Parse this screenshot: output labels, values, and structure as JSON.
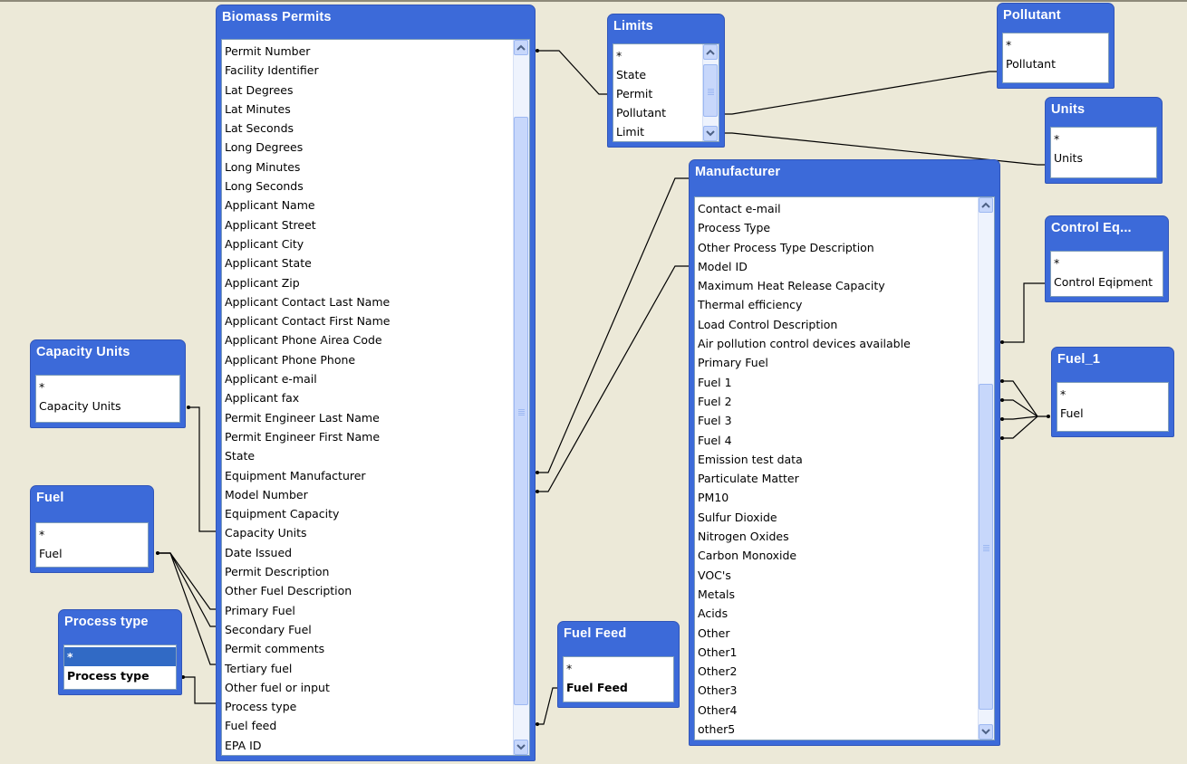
{
  "tables": {
    "biomass_permits": {
      "title": "Biomass Permits",
      "fields": [
        "Permit Number",
        "Facility Identifier",
        "Lat Degrees",
        "Lat Minutes",
        "Lat Seconds",
        "Long Degrees",
        "Long Minutes",
        "Long Seconds",
        "Applicant Name",
        "Applicant Street",
        "Applicant City",
        "Applicant State",
        "Applicant Zip",
        "Applicant Contact Last Name",
        "Applicant Contact First Name",
        "Applicant Phone Airea Code",
        "Applicant Phone Phone",
        "Applicant e-mail",
        "Applicant fax",
        "Permit Engineer Last Name",
        "Permit Engineer First Name",
        "State",
        "Equipment Manufacturer",
        "Model Number",
        "Equipment Capacity",
        "Capacity Units",
        "Date Issued",
        "Permit Description",
        "Other Fuel Description",
        "Primary Fuel",
        "Secondary Fuel",
        "Permit comments",
        "Tertiary fuel",
        "Other fuel or input",
        "Process type",
        "Fuel feed",
        "EPA ID"
      ]
    },
    "limits": {
      "title": "Limits",
      "fields": [
        "*",
        "State",
        "Permit",
        "Pollutant",
        "Limit"
      ]
    },
    "pollutant": {
      "title": "Pollutant",
      "fields": [
        "*",
        "Pollutant"
      ]
    },
    "units": {
      "title": "Units",
      "fields": [
        "*",
        "Units"
      ]
    },
    "manufacturer": {
      "title": "Manufacturer",
      "fields": [
        "Contact e-mail",
        "Process Type",
        "Other Process Type Description",
        "Model ID",
        "Maximum Heat Release Capacity",
        "Thermal efficiency",
        "Load Control Description",
        "Air pollution control devices available",
        "Primary Fuel",
        "Fuel 1",
        "Fuel 2",
        "Fuel 3",
        "Fuel 4",
        "Emission test data",
        "Particulate Matter",
        "PM10",
        "Sulfur Dioxide",
        "Nitrogen Oxides",
        "Carbon Monoxide",
        "VOC's",
        "Metals",
        "Acids",
        "Other",
        "Other1",
        "Other2",
        "Other3",
        "Other4",
        "other5"
      ]
    },
    "control_equipment": {
      "title": "Control Eq...",
      "fields": [
        "*",
        "Control Eqipment"
      ]
    },
    "fuel_1": {
      "title": "Fuel_1",
      "fields": [
        "*",
        "Fuel"
      ]
    },
    "capacity_units": {
      "title": "Capacity Units",
      "fields": [
        "*",
        "Capacity Units"
      ]
    },
    "fuel": {
      "title": "Fuel",
      "fields": [
        "*",
        "Fuel"
      ]
    },
    "process_type": {
      "title": "Process type",
      "fields": [
        "*",
        "Process type"
      ],
      "selected_field": "*"
    },
    "fuel_feed": {
      "title": "Fuel Feed",
      "fields": [
        "*",
        "Fuel Feed"
      ]
    }
  },
  "icons": {
    "scroll_up": "chevron-up-icon",
    "scroll_down": "chevron-down-icon"
  },
  "colors": {
    "title_bar": "#3c6ad9",
    "workspace": "#ece9d8",
    "selection": "#316ac5",
    "scrollbar": "#c7d7fb"
  }
}
